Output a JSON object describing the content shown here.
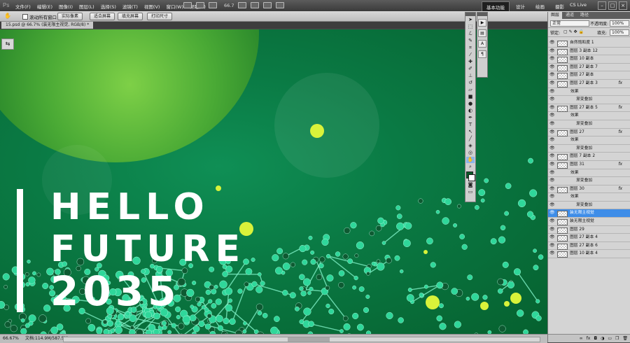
{
  "app": {
    "logo": "Ps"
  },
  "menu": [
    "文件(F)",
    "编辑(E)",
    "图像(I)",
    "图层(L)",
    "选择(S)",
    "滤镜(T)",
    "视图(V)",
    "窗口(W)",
    "帮助(H)"
  ],
  "toolbar_view": {
    "zoom": "66.7"
  },
  "workspace": {
    "tabs": [
      "基本功能",
      "设计",
      "绘画",
      "摄影"
    ],
    "active_index": 0
  },
  "cs_live": "CS Live",
  "options_bar": {
    "scroll_all_windows": "滚动所有窗口",
    "buttons": [
      "实际像素",
      "适合屏幕",
      "填充屏幕",
      "打印尺寸"
    ]
  },
  "document": {
    "tab_title": "15.psd @ 66.7% (装无限主视觉, RGB/8) *"
  },
  "artwork": {
    "line1": "HELLO",
    "line2": "FUTURE",
    "line3": "2035",
    "colors": {
      "bg": "#0a7a44",
      "planet": "#4aaa35",
      "molecule": "#2fd79a",
      "dot": "#d9f23a"
    }
  },
  "status": {
    "zoom": "66.67%",
    "doc_size": "文档:114.9M/587.5M"
  },
  "panels": {
    "tabs": [
      "图层",
      "通道",
      "路径"
    ],
    "blend_mode": "正常",
    "opacity_label": "不透明度:",
    "opacity_value": "100%",
    "lock_label": "锁定:",
    "fill_label": "填充:",
    "fill_value": "100%"
  },
  "layers": [
    {
      "name": "自然饱和度 1",
      "fx": "",
      "type": "layer"
    },
    {
      "name": "图层 3 副本 12",
      "fx": "",
      "type": "layer"
    },
    {
      "name": "图层 10 副本",
      "fx": "",
      "type": "layer"
    },
    {
      "name": "图层 27 副本 7",
      "fx": "",
      "type": "layer"
    },
    {
      "name": "图层 27 副本",
      "fx": "",
      "type": "layer"
    },
    {
      "name": "图层 27 副本 3",
      "fx": "fx",
      "type": "layer"
    },
    {
      "name": "效果",
      "fx": "",
      "type": "effect"
    },
    {
      "name": "渐变叠加",
      "fx": "",
      "type": "effect-item"
    },
    {
      "name": "图层 27 副本 5",
      "fx": "fx",
      "type": "layer"
    },
    {
      "name": "效果",
      "fx": "",
      "type": "effect"
    },
    {
      "name": "渐变叠加",
      "fx": "",
      "type": "effect-item"
    },
    {
      "name": "图层 27",
      "fx": "fx",
      "type": "layer"
    },
    {
      "name": "效果",
      "fx": "",
      "type": "effect"
    },
    {
      "name": "渐变叠加",
      "fx": "",
      "type": "effect-item"
    },
    {
      "name": "图层 7 副本 2",
      "fx": "",
      "type": "layer"
    },
    {
      "name": "图层 31",
      "fx": "fx",
      "type": "layer"
    },
    {
      "name": "效果",
      "fx": "",
      "type": "effect"
    },
    {
      "name": "渐变叠加",
      "fx": "",
      "type": "effect-item"
    },
    {
      "name": "图层 30",
      "fx": "fx",
      "type": "layer"
    },
    {
      "name": "效果",
      "fx": "",
      "type": "effect"
    },
    {
      "name": "渐变叠加",
      "fx": "",
      "type": "effect-item"
    },
    {
      "name": "装无限主视觉",
      "fx": "",
      "type": "layer",
      "selected": true
    },
    {
      "name": "装无限主视觉",
      "fx": "",
      "type": "layer"
    },
    {
      "name": "图层 29",
      "fx": "",
      "type": "layer"
    },
    {
      "name": "图层 27 副本 4",
      "fx": "",
      "type": "layer"
    },
    {
      "name": "图层 27 副本 6",
      "fx": "",
      "type": "layer"
    },
    {
      "name": "图层 10 副本 4",
      "fx": "",
      "type": "layer"
    }
  ]
}
